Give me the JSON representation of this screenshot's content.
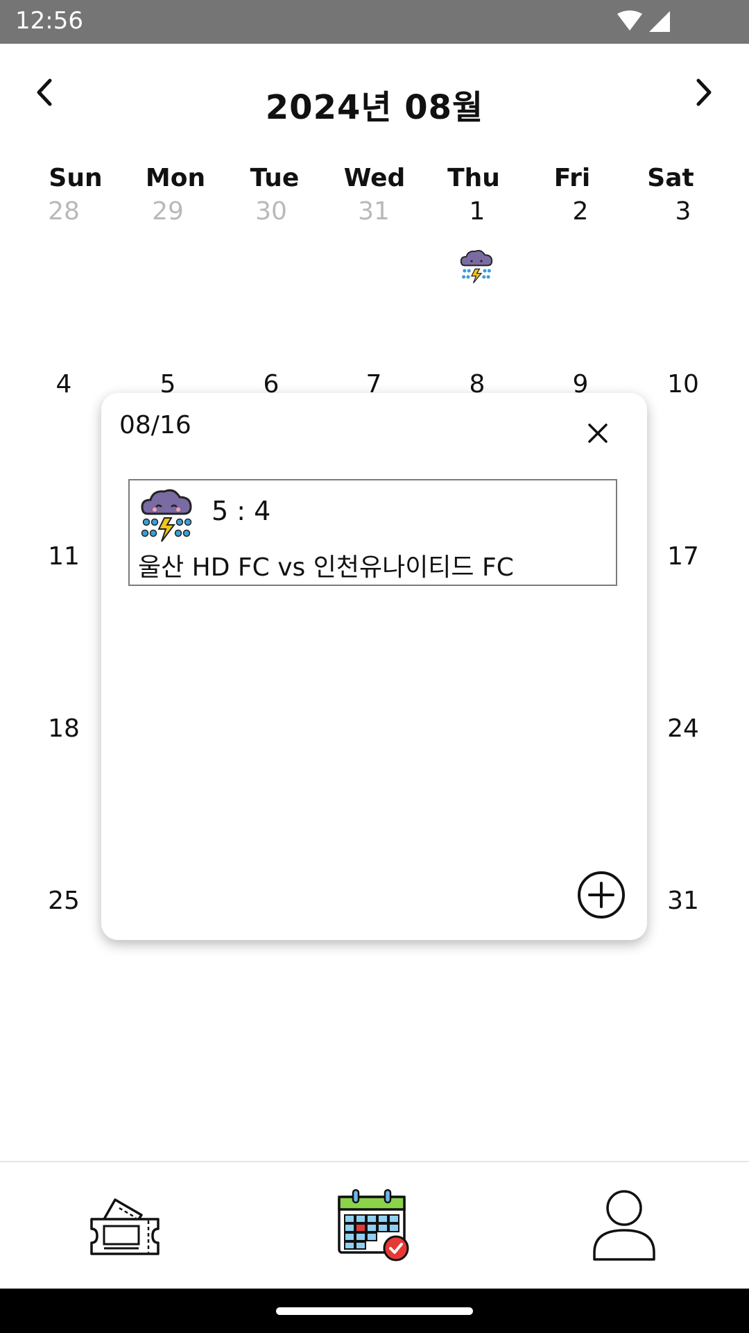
{
  "status_bar": {
    "time": "12:56"
  },
  "header": {
    "title": "2024년 08월",
    "prev_icon": "chevron-left-icon",
    "next_icon": "chevron-right-icon"
  },
  "weekdays": [
    "Sun",
    "Mon",
    "Tue",
    "Wed",
    "Thu",
    "Fri",
    "Sat"
  ],
  "weeks": [
    [
      "28",
      "29",
      "30",
      "31",
      "1",
      "2",
      "3"
    ],
    [
      "4",
      "5",
      "6",
      "7",
      "8",
      "9",
      "10"
    ],
    [
      "11",
      "",
      "",
      "",
      "",
      "",
      "17"
    ],
    [
      "18",
      "",
      "",
      "",
      "",
      "",
      "24"
    ],
    [
      "25",
      "",
      "",
      "",
      "",
      "",
      "31"
    ]
  ],
  "muted_days": [
    "28",
    "29",
    "30",
    "31"
  ],
  "weather_day": {
    "day": "1",
    "icon": "storm-cloud-icon"
  },
  "modal": {
    "date": "08/16",
    "game": {
      "score": "5 : 4",
      "match": "울산 HD FC vs 인천유나이티드 FC",
      "icon": "storm-cloud-icon"
    },
    "close_icon": "close-icon",
    "add_icon": "add-circle-icon"
  },
  "bottom_nav": [
    {
      "name": "ticket",
      "icon": "ticket-icon"
    },
    {
      "name": "calendar",
      "icon": "calendar-icon",
      "active": true
    },
    {
      "name": "profile",
      "icon": "profile-icon"
    }
  ],
  "colors": {
    "status_bar": "#757575",
    "muted_day": "#b9b9b9",
    "cloud": "#7b6ba3",
    "rain": "#3aa0d8",
    "bolt": "#f5c518",
    "calendar_header": "#8cd34a",
    "calendar_mark": "#e53935"
  }
}
